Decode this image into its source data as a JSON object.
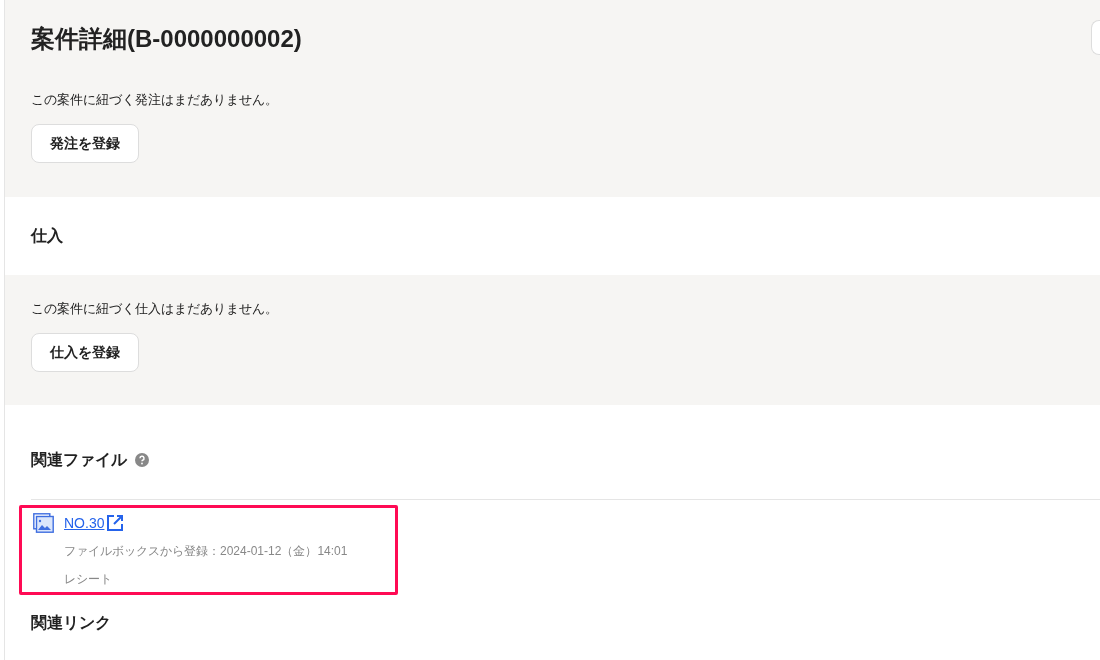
{
  "title": "案件詳細(B-0000000002)",
  "orders": {
    "empty_message": "この案件に紐づく発注はまだありません。",
    "button": "発注を登録"
  },
  "purchases": {
    "heading": "仕入",
    "empty_message": "この案件に紐づく仕入はまだありません。",
    "button": "仕入を登録"
  },
  "related_files": {
    "heading": "関連ファイル",
    "files": [
      {
        "name": "NO.30",
        "meta": "ファイルボックスから登録：2024-01-12（金）14:01",
        "category": "レシート",
        "highlighted": true
      }
    ]
  },
  "related_links": {
    "heading": "関連リンク"
  }
}
